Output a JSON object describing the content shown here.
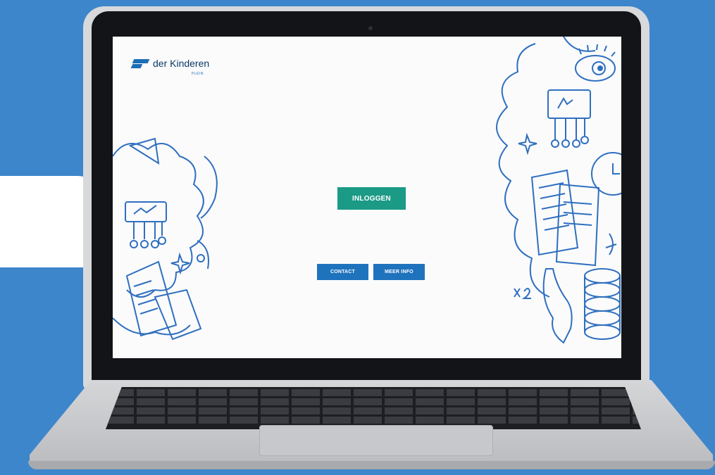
{
  "brand": {
    "name": "der Kinderen",
    "sub": "PLEIN",
    "color": "#1c6eb5"
  },
  "actions": {
    "login_label": "INLOGGEN",
    "contact_label": "CONTACT",
    "info_label": "MEER INFO"
  },
  "colors": {
    "background": "#3d86cc",
    "login": "#1b9a86",
    "secondary": "#1f73bd",
    "doodle": "#2f6fbf"
  },
  "icons": [
    "logo-mark-icon",
    "doodle-left-illustration",
    "doodle-right-illustration",
    "camera-icon"
  ]
}
